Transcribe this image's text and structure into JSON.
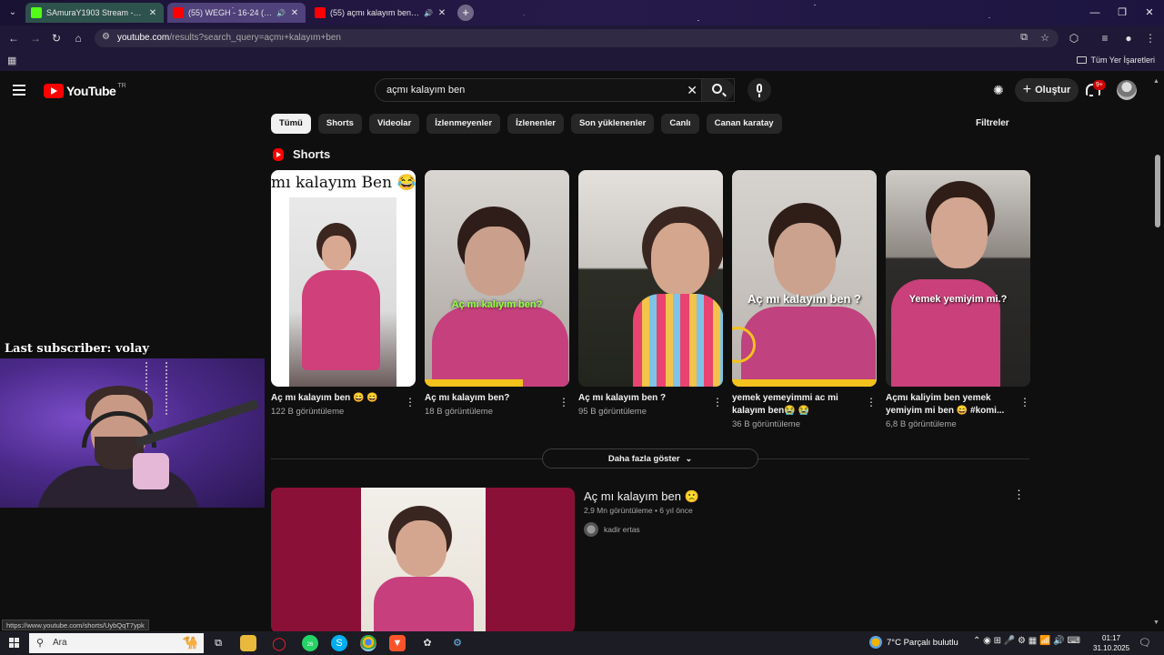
{
  "browser": {
    "tabs": [
      {
        "title": "SAmuraY1903 Stream - Kick D...",
        "favicon_color": "#53fc18"
      },
      {
        "title": "(55) WEGH - 16-24 (Officia...",
        "favicon_color": "#ff0000"
      },
      {
        "title": "(55) açmı kalayım ben - Yo...",
        "favicon_color": "#ff0000"
      }
    ],
    "url_host": "youtube.com",
    "url_path": "/results?search_query=açmı+kalayım+ben",
    "all_bookmarks": "Tüm Yer İşaretleri"
  },
  "youtube": {
    "logo": "YouTube",
    "logo_country": "TR",
    "search_value": "açmı kalayım ben",
    "create_label": "Oluştur",
    "notif_badge": "9+",
    "chips": [
      "Tümü",
      "Shorts",
      "Videolar",
      "İzlenmeyenler",
      "İzlenenler",
      "Son yüklenenler",
      "Canlı",
      "Canan karatay"
    ],
    "filters_label": "Filtreler",
    "shorts_heading": "Shorts",
    "shorts": [
      {
        "title": "Aç mı kalayım ben 😄 😄",
        "views": "122 B görüntüleme",
        "overlay": "mı kalayım Ben 😂"
      },
      {
        "title": "Aç mı kalayım ben?",
        "views": "18 B görüntüleme",
        "overlay": "Aç mı kalıyım ben?"
      },
      {
        "title": "Aç mı kalayım ben ?",
        "views": "95 B görüntüleme",
        "overlay": ""
      },
      {
        "title": "yemek yemeyimmi ac mi kalayım ben😭 😭",
        "views": "36 B görüntüleme",
        "overlay": "Aç mı kalayım ben ?"
      },
      {
        "title": "Açmı kaliyim ben yemek yemiyim mi ben 😄 #komi...",
        "views": "6,8 B görüntüleme",
        "overlay": "Yemek yemiyim mi.?"
      }
    ],
    "show_more": "Daha fazla göster",
    "video": {
      "title": "Aç mı kalayım ben 🙁",
      "meta": "2,9 Mn görüntüleme • 6 yıl önce",
      "channel": "kadir ertas"
    },
    "status_url": "https://www.youtube.com/shorts/UybQqT7ypk"
  },
  "overlay": {
    "subscriber_label": "Last subscriber: volay"
  },
  "taskbar": {
    "search_placeholder": "Ara",
    "weather": "7°C  Parçalı bulutlu",
    "time": "01:17",
    "date": "31.10.2025",
    "whatsapp_badge": "26"
  }
}
